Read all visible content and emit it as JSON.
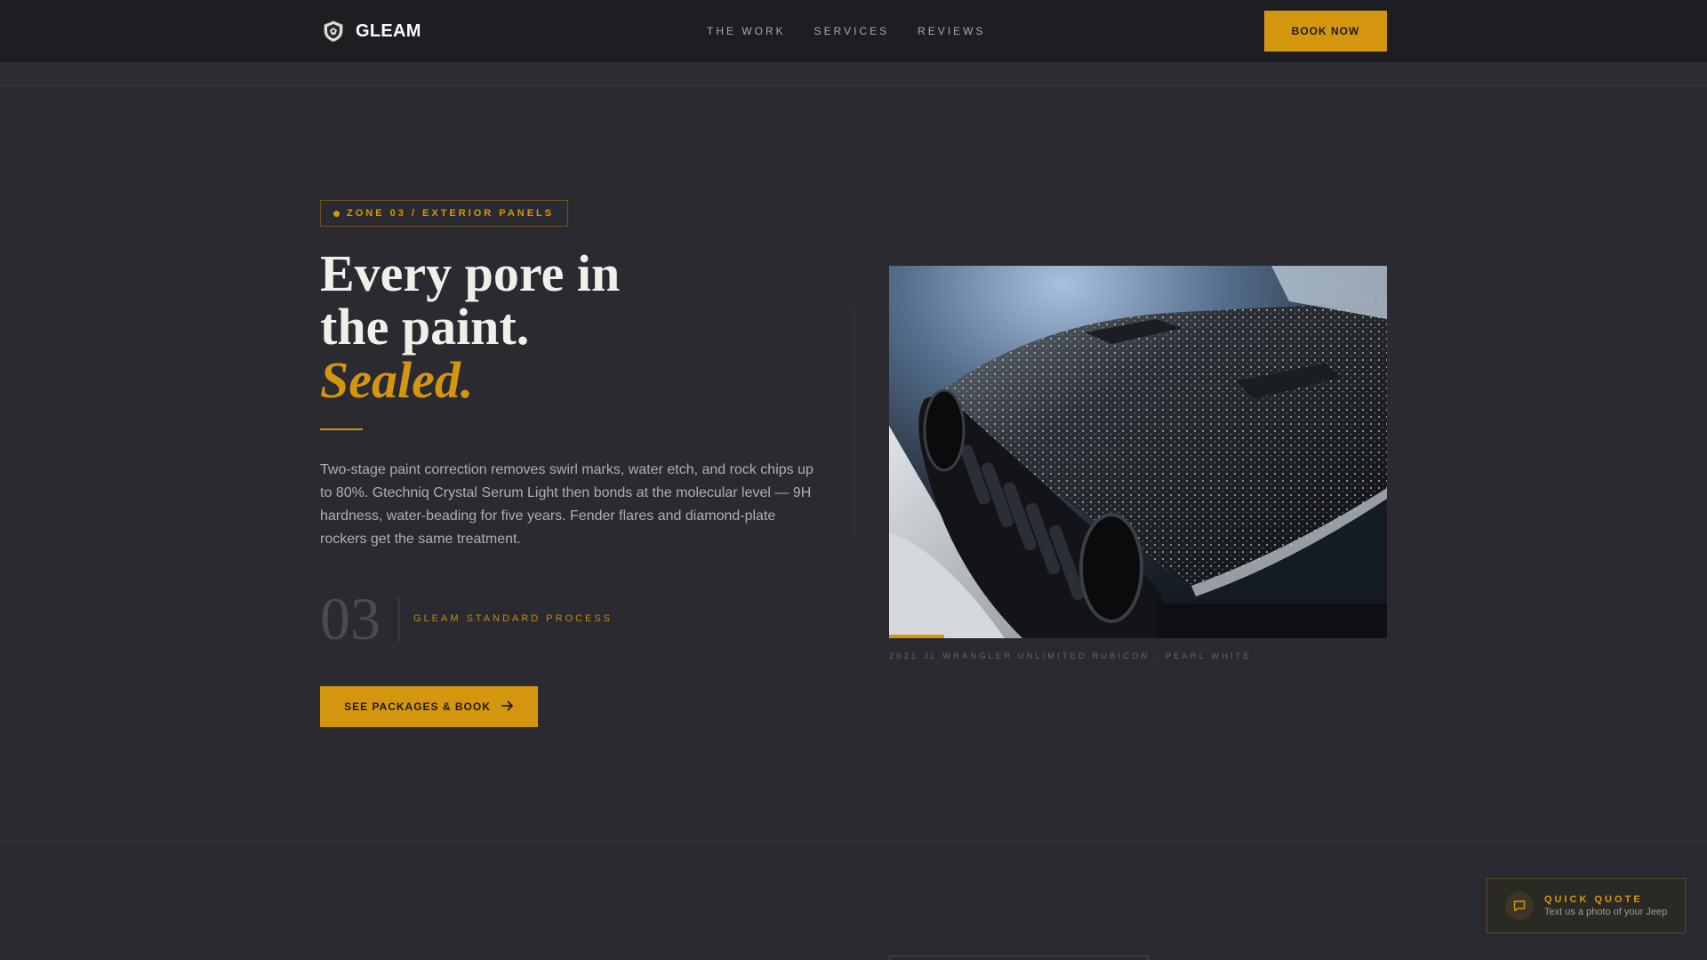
{
  "header": {
    "brand": "GLEAM",
    "nav": [
      "THE WORK",
      "SERVICES",
      "REVIEWS"
    ],
    "book_now": "BOOK NOW"
  },
  "hero": {
    "tag": "ZONE 03 / EXTERIOR PANELS",
    "headline_line1": "Every pore in",
    "headline_line2": "the paint.",
    "headline_accent": "Sealed.",
    "body": "Two-stage paint correction removes swirl marks, water etch, and rock chips up to 80%. Gtechniq Crystal Serum Light then bonds at the molecular level — 9H hardness, water-beading for five years. Fender flares and diamond-plate rockers get the same treatment.",
    "step_number": "03",
    "step_label": "GLEAM STANDARD PROCESS",
    "cta": "SEE PACKAGES & BOOK"
  },
  "photo": {
    "caption": "2021 JL WRANGLER UNLIMITED RUBICON · PEARL WHITE",
    "progress": 0.11
  },
  "quick_quote": {
    "title": "QUICK QUOTE",
    "subtitle": "Text us a photo of your Jeep"
  },
  "colors": {
    "accent": "#d4960e",
    "background": "#2b2a30",
    "header": "#1e1d22"
  },
  "icons": {
    "logo": "shield-logo-icon",
    "cta_arrow": "arrow-right-icon",
    "chat": "chat-bubble-icon"
  }
}
